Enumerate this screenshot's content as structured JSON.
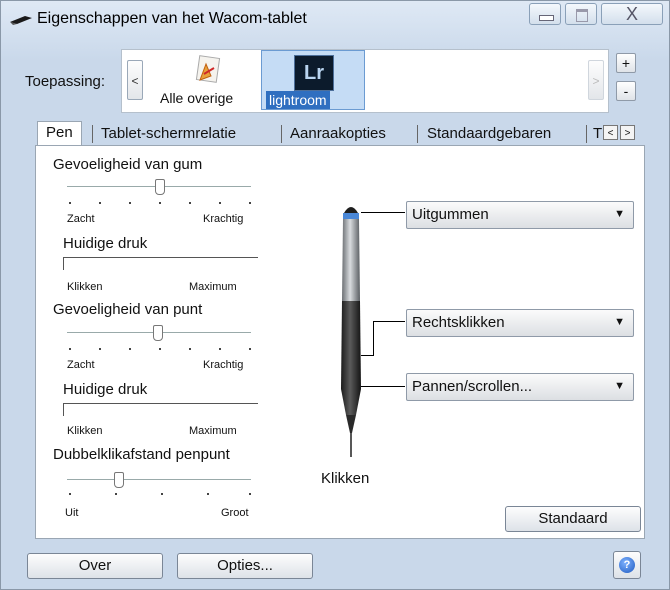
{
  "window": {
    "title": "Eigenschappen van het Wacom-tablet",
    "close_glyph": "X"
  },
  "application": {
    "label": "Toepassing:",
    "scroll_left": "<",
    "scroll_right": ">",
    "items": [
      {
        "label": "Alle overige",
        "icon": "all-applications-icon",
        "selected": false
      },
      {
        "label": "lightroom",
        "icon_text": "Lr",
        "selected": true
      }
    ],
    "add": "+",
    "remove": "-"
  },
  "tabs": {
    "items": [
      "Pen",
      "Tablet-schermrelatie",
      "Aanraakopties",
      "Standaardgebaren",
      "T"
    ],
    "active": "Pen",
    "prev": "<",
    "next": ">"
  },
  "eraser_feel": {
    "label": "Gevoeligheid van gum",
    "min": "Zacht",
    "max": "Krachtig",
    "level": 0.5
  },
  "eraser_pressure": {
    "label": "Huidige druk",
    "min": "Klikken",
    "max": "Maximum"
  },
  "tip_feel": {
    "label": "Gevoeligheid van punt",
    "min": "Zacht",
    "max": "Krachtig",
    "level": 0.5
  },
  "tip_pressure": {
    "label": "Huidige druk",
    "min": "Klikken",
    "max": "Maximum"
  },
  "double_click": {
    "label": "Dubbelklikafstand penpunt",
    "min": "Uit",
    "max": "Groot",
    "level": 0.25
  },
  "pen_buttons": {
    "eraser": "Uitgummen",
    "upper_button": "Rechtsklikken",
    "lower_button": "Pannen/scrollen...",
    "tip": "Klikken",
    "arrow": "▼"
  },
  "buttons": {
    "default": "Standaard",
    "about": "Over",
    "options": "Opties...",
    "help": "?"
  },
  "colors": {
    "accent": "#2f6fc0",
    "selection": "#c5dcf5"
  }
}
